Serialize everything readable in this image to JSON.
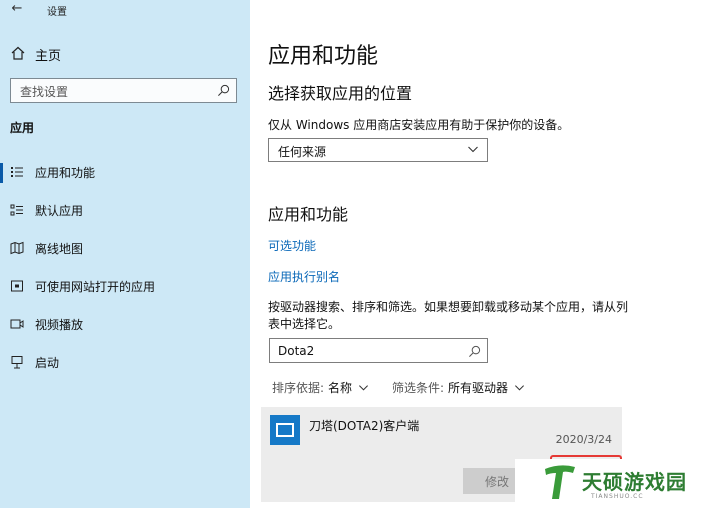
{
  "window": {
    "title": "设置"
  },
  "sidebar": {
    "home_label": "主页",
    "search_placeholder": "查找设置",
    "section_title": "应用",
    "items": [
      {
        "label": "应用和功能",
        "icon": "list-detail-icon",
        "active": true
      },
      {
        "label": "默认应用",
        "icon": "list-default-icon",
        "active": false
      },
      {
        "label": "离线地图",
        "icon": "map-icon",
        "active": false
      },
      {
        "label": "可使用网站打开的应用",
        "icon": "website-app-icon",
        "active": false
      },
      {
        "label": "视频播放",
        "icon": "video-icon",
        "active": false
      },
      {
        "label": "启动",
        "icon": "startup-icon",
        "active": false
      }
    ]
  },
  "main": {
    "page_title": "应用和功能",
    "source_title": "选择获取应用的位置",
    "source_desc": "仅从 Windows 应用商店安装应用有助于保护你的设备。",
    "source_value": "任何来源",
    "apps_title": "应用和功能",
    "link_optional": "可选功能",
    "link_alias": "应用执行别名",
    "instructions": "按驱动器搜索、排序和筛选。如果想要卸载或移动某个应用，请从列表中选择它。",
    "search_value": "Dota2",
    "sort_key": "排序依据:",
    "sort_value": "名称",
    "filter_key": "筛选条件:",
    "filter_value": "所有驱动器",
    "app": {
      "name": "刀塔(DOTA2)客户端",
      "date": "2020/3/24",
      "modify_label": "修改"
    }
  },
  "watermark": {
    "text": "天硕游戏园",
    "sub": "TIANSHUO.CC"
  },
  "colors": {
    "sidebar_bg": "#cde8f6",
    "accent": "#0a68b8",
    "highlight": "#e53935"
  }
}
